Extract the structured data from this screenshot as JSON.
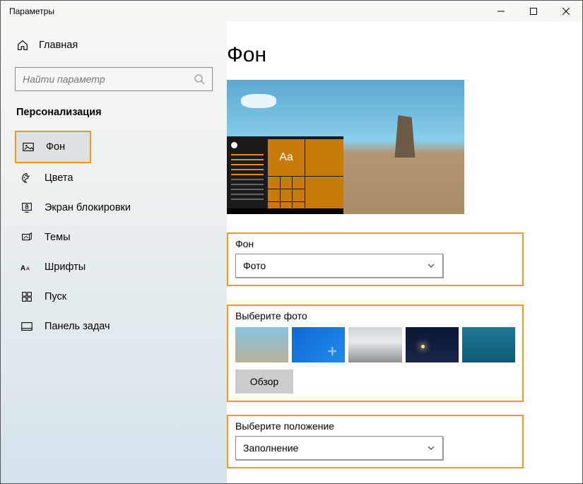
{
  "window": {
    "title": "Параметры"
  },
  "sidebar": {
    "home": "Главная",
    "search_placeholder": "Найти параметр",
    "section": "Персонализация",
    "items": [
      {
        "label": "Фон",
        "icon": "image-icon",
        "active": true
      },
      {
        "label": "Цвета",
        "icon": "palette-icon"
      },
      {
        "label": "Экран блокировки",
        "icon": "lock-screen-icon"
      },
      {
        "label": "Темы",
        "icon": "themes-icon"
      },
      {
        "label": "Шрифты",
        "icon": "fonts-icon"
      },
      {
        "label": "Пуск",
        "icon": "start-icon"
      },
      {
        "label": "Панель задач",
        "icon": "taskbar-icon"
      }
    ]
  },
  "main": {
    "title": "Фон",
    "preview_tile_label": "Aa",
    "bg_section": {
      "label": "Фон",
      "value": "Фото"
    },
    "photo_section": {
      "label": "Выберите фото",
      "browse": "Обзор"
    },
    "fit_section": {
      "label": "Выберите положение",
      "value": "Заполнение"
    }
  }
}
